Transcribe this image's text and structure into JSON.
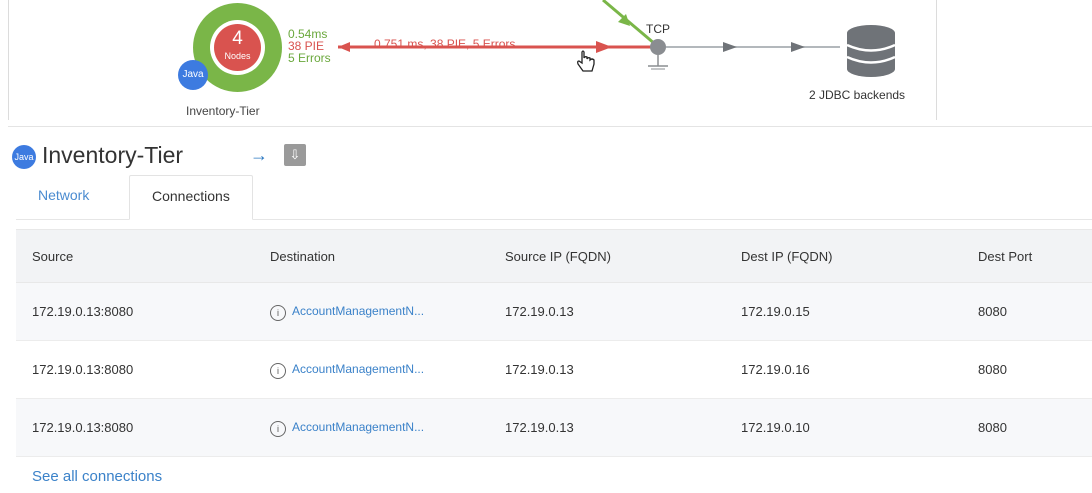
{
  "flow_map": {
    "tier": {
      "count": "4",
      "count_label": "Nodes",
      "platform": "Java",
      "name": "Inventory-Tier",
      "stat_time": "0.54ms",
      "stat_pie": "38 PIE",
      "stat_errors": "5 Errors"
    },
    "edge_label": "0.751 ms, 38 PIE, 5 Errors",
    "tcp_label": "TCP",
    "backend_label": "2 JDBC backends",
    "colors": {
      "tier_ring": "#7ab648",
      "tier_core": "#d9534f",
      "error_edge": "#d9534f",
      "java_badge": "#3d7be0",
      "database": "#6f7378"
    }
  },
  "panel": {
    "platform": "Java",
    "title": "Inventory-Tier",
    "arrow_icon": "right-arrow-icon",
    "download_icon": "download-icon",
    "tabs": [
      {
        "label": "Network",
        "active": false
      },
      {
        "label": "Connections",
        "active": true
      }
    ],
    "table": {
      "columns": [
        "Source",
        "Destination",
        "Source IP (FQDN)",
        "Dest IP (FQDN)",
        "Dest Port"
      ],
      "rows": [
        {
          "source": "172.19.0.13:8080",
          "destination": "AccountManagementN...",
          "source_ip": "172.19.0.13",
          "dest_ip": "172.19.0.15",
          "dest_port": "8080"
        },
        {
          "source": "172.19.0.13:8080",
          "destination": "AccountManagementN...",
          "source_ip": "172.19.0.13",
          "dest_ip": "172.19.0.16",
          "dest_port": "8080"
        },
        {
          "source": "172.19.0.13:8080",
          "destination": "AccountManagementN...",
          "source_ip": "172.19.0.13",
          "dest_ip": "172.19.0.10",
          "dest_port": "8080"
        }
      ]
    },
    "see_all_label": "See all connections"
  }
}
